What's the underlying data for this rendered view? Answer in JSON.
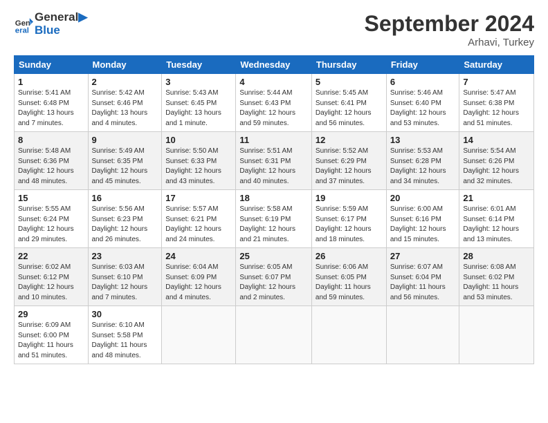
{
  "header": {
    "logo_line1": "General",
    "logo_line2": "Blue",
    "month": "September 2024",
    "location": "Arhavi, Turkey"
  },
  "weekdays": [
    "Sunday",
    "Monday",
    "Tuesday",
    "Wednesday",
    "Thursday",
    "Friday",
    "Saturday"
  ],
  "weeks": [
    [
      {
        "day": "1",
        "detail": "Sunrise: 5:41 AM\nSunset: 6:48 PM\nDaylight: 13 hours\nand 7 minutes."
      },
      {
        "day": "2",
        "detail": "Sunrise: 5:42 AM\nSunset: 6:46 PM\nDaylight: 13 hours\nand 4 minutes."
      },
      {
        "day": "3",
        "detail": "Sunrise: 5:43 AM\nSunset: 6:45 PM\nDaylight: 13 hours\nand 1 minute."
      },
      {
        "day": "4",
        "detail": "Sunrise: 5:44 AM\nSunset: 6:43 PM\nDaylight: 12 hours\nand 59 minutes."
      },
      {
        "day": "5",
        "detail": "Sunrise: 5:45 AM\nSunset: 6:41 PM\nDaylight: 12 hours\nand 56 minutes."
      },
      {
        "day": "6",
        "detail": "Sunrise: 5:46 AM\nSunset: 6:40 PM\nDaylight: 12 hours\nand 53 minutes."
      },
      {
        "day": "7",
        "detail": "Sunrise: 5:47 AM\nSunset: 6:38 PM\nDaylight: 12 hours\nand 51 minutes."
      }
    ],
    [
      {
        "day": "8",
        "detail": "Sunrise: 5:48 AM\nSunset: 6:36 PM\nDaylight: 12 hours\nand 48 minutes."
      },
      {
        "day": "9",
        "detail": "Sunrise: 5:49 AM\nSunset: 6:35 PM\nDaylight: 12 hours\nand 45 minutes."
      },
      {
        "day": "10",
        "detail": "Sunrise: 5:50 AM\nSunset: 6:33 PM\nDaylight: 12 hours\nand 43 minutes."
      },
      {
        "day": "11",
        "detail": "Sunrise: 5:51 AM\nSunset: 6:31 PM\nDaylight: 12 hours\nand 40 minutes."
      },
      {
        "day": "12",
        "detail": "Sunrise: 5:52 AM\nSunset: 6:29 PM\nDaylight: 12 hours\nand 37 minutes."
      },
      {
        "day": "13",
        "detail": "Sunrise: 5:53 AM\nSunset: 6:28 PM\nDaylight: 12 hours\nand 34 minutes."
      },
      {
        "day": "14",
        "detail": "Sunrise: 5:54 AM\nSunset: 6:26 PM\nDaylight: 12 hours\nand 32 minutes."
      }
    ],
    [
      {
        "day": "15",
        "detail": "Sunrise: 5:55 AM\nSunset: 6:24 PM\nDaylight: 12 hours\nand 29 minutes."
      },
      {
        "day": "16",
        "detail": "Sunrise: 5:56 AM\nSunset: 6:23 PM\nDaylight: 12 hours\nand 26 minutes."
      },
      {
        "day": "17",
        "detail": "Sunrise: 5:57 AM\nSunset: 6:21 PM\nDaylight: 12 hours\nand 24 minutes."
      },
      {
        "day": "18",
        "detail": "Sunrise: 5:58 AM\nSunset: 6:19 PM\nDaylight: 12 hours\nand 21 minutes."
      },
      {
        "day": "19",
        "detail": "Sunrise: 5:59 AM\nSunset: 6:17 PM\nDaylight: 12 hours\nand 18 minutes."
      },
      {
        "day": "20",
        "detail": "Sunrise: 6:00 AM\nSunset: 6:16 PM\nDaylight: 12 hours\nand 15 minutes."
      },
      {
        "day": "21",
        "detail": "Sunrise: 6:01 AM\nSunset: 6:14 PM\nDaylight: 12 hours\nand 13 minutes."
      }
    ],
    [
      {
        "day": "22",
        "detail": "Sunrise: 6:02 AM\nSunset: 6:12 PM\nDaylight: 12 hours\nand 10 minutes."
      },
      {
        "day": "23",
        "detail": "Sunrise: 6:03 AM\nSunset: 6:10 PM\nDaylight: 12 hours\nand 7 minutes."
      },
      {
        "day": "24",
        "detail": "Sunrise: 6:04 AM\nSunset: 6:09 PM\nDaylight: 12 hours\nand 4 minutes."
      },
      {
        "day": "25",
        "detail": "Sunrise: 6:05 AM\nSunset: 6:07 PM\nDaylight: 12 hours\nand 2 minutes."
      },
      {
        "day": "26",
        "detail": "Sunrise: 6:06 AM\nSunset: 6:05 PM\nDaylight: 11 hours\nand 59 minutes."
      },
      {
        "day": "27",
        "detail": "Sunrise: 6:07 AM\nSunset: 6:04 PM\nDaylight: 11 hours\nand 56 minutes."
      },
      {
        "day": "28",
        "detail": "Sunrise: 6:08 AM\nSunset: 6:02 PM\nDaylight: 11 hours\nand 53 minutes."
      }
    ],
    [
      {
        "day": "29",
        "detail": "Sunrise: 6:09 AM\nSunset: 6:00 PM\nDaylight: 11 hours\nand 51 minutes."
      },
      {
        "day": "30",
        "detail": "Sunrise: 6:10 AM\nSunset: 5:58 PM\nDaylight: 11 hours\nand 48 minutes."
      },
      null,
      null,
      null,
      null,
      null
    ]
  ]
}
